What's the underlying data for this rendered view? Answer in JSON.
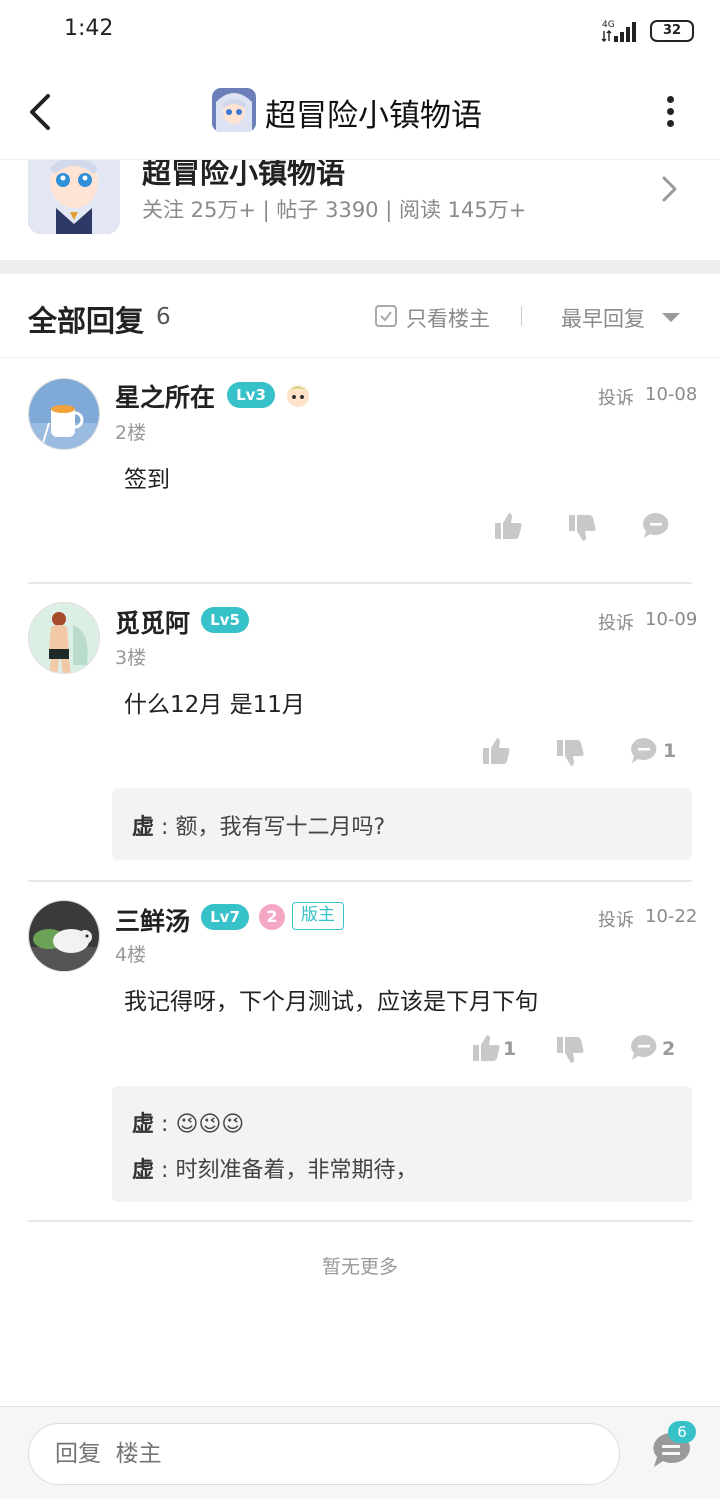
{
  "status_bar": {
    "time": "1:42",
    "network": "4G",
    "battery": "32"
  },
  "header": {
    "title": "超冒险小镇物语"
  },
  "forum": {
    "name": "超冒险小镇物语",
    "stats": "关注 25万+ | 帖子 3390 | 阅读 145万+"
  },
  "replies_header": {
    "title": "全部回复",
    "count": "6",
    "only_op_label": "只看楼主",
    "sort_label": "最早回复"
  },
  "posts": [
    {
      "username": "星之所在",
      "level": "Lv3",
      "floor": "2楼",
      "report": "投诉",
      "date": "10-08",
      "content": "签到",
      "likes": "",
      "comments": "",
      "sub_replies": []
    },
    {
      "username": "觅觅阿",
      "level": "Lv5",
      "floor": "3楼",
      "report": "投诉",
      "date": "10-09",
      "content": "什么12月 是11月",
      "likes": "",
      "comments": "1",
      "sub_replies": [
        {
          "name": "虚",
          "sep": ":",
          "text": "额，我有写十二月吗?"
        }
      ]
    },
    {
      "username": "三鲜汤",
      "level": "Lv7",
      "badge_number": "2",
      "role": "版主",
      "floor": "4楼",
      "report": "投诉",
      "date": "10-22",
      "content": "我记得呀，下个月测试，应该是下月下旬",
      "likes": "1",
      "comments": "2",
      "sub_replies": [
        {
          "name": "虚",
          "sep": ":",
          "text": "😉😉😉"
        },
        {
          "name": "虚",
          "sep": ":",
          "text": "时刻准备着，非常期待，"
        }
      ]
    }
  ],
  "no_more": "暂无更多",
  "bottom_bar": {
    "reply_placeholder": "回复  楼主",
    "comment_count": "6"
  },
  "colors": {
    "accent": "#37c2c9",
    "muted": "#999999",
    "divider": "#e6e6e6"
  }
}
